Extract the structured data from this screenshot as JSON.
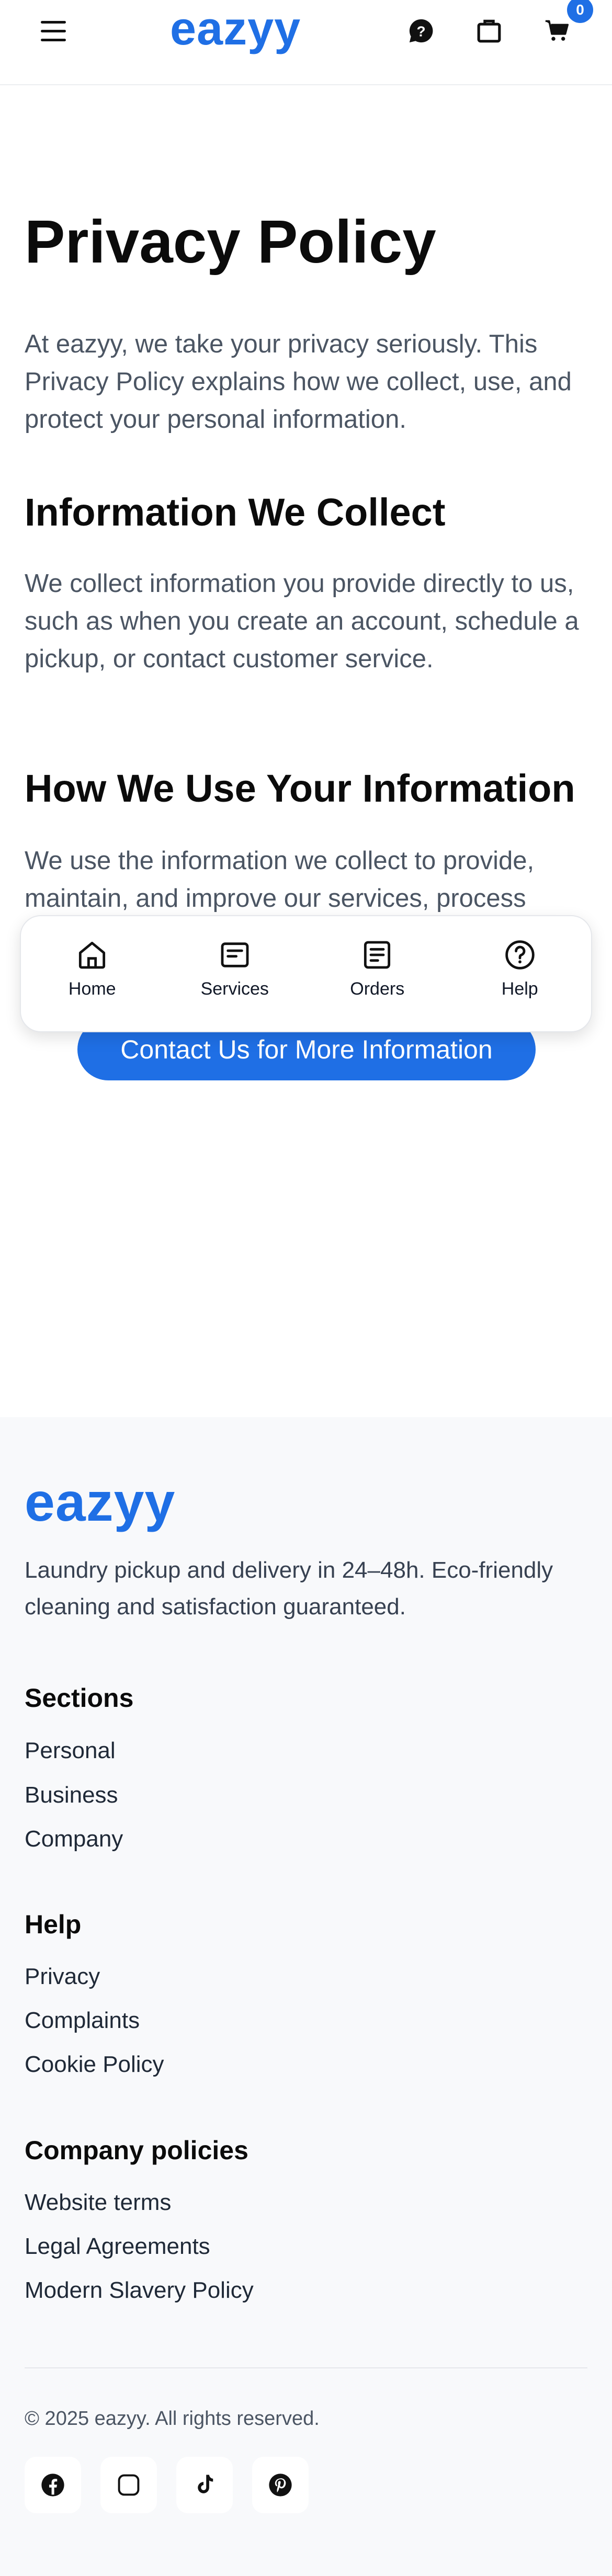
{
  "header": {
    "logo": "eazyy",
    "cart_count": "0"
  },
  "main": {
    "title": "Privacy Policy",
    "intro": "At eazyy, we take your privacy seriously. This Privacy Policy explains how we collect, use, and protect your personal information.",
    "sections": [
      {
        "heading": "Information We Collect",
        "body": "We collect information you provide directly to us, such as when you create an account, schedule a pickup, or contact customer service."
      },
      {
        "heading": "How We Use Your Information",
        "body": "We use the information we collect to provide, maintain, and improve our services, process"
      }
    ],
    "contact_button": "Contact Us for More Information"
  },
  "bottom_nav": {
    "items": [
      {
        "label": "Home",
        "icon": "home-icon"
      },
      {
        "label": "Services",
        "icon": "services-icon"
      },
      {
        "label": "Orders",
        "icon": "orders-icon"
      },
      {
        "label": "Help",
        "icon": "help-icon"
      }
    ]
  },
  "footer": {
    "logo": "eazyy",
    "tagline": "Laundry pickup and delivery in 24–48h. Eco-friendly cleaning and satisfaction guaranteed.",
    "groups": [
      {
        "heading": "Sections",
        "links": [
          "Personal",
          "Business",
          "Company"
        ]
      },
      {
        "heading": "Help",
        "links": [
          "Privacy",
          "Complaints",
          "Cookie Policy"
        ]
      },
      {
        "heading": "Company policies",
        "links": [
          "Website terms",
          "Legal Agreements",
          "Modern Slavery Policy"
        ]
      }
    ],
    "copyright": "© 2025 eazyy. All rights reserved.",
    "social": [
      "facebook-icon",
      "instagram-icon",
      "tiktok-icon",
      "pinterest-icon"
    ]
  },
  "colors": {
    "brand": "#1f6fe5",
    "text": "#0b0b0b",
    "muted": "#4b5563",
    "footer_bg": "#f8f9fb"
  }
}
